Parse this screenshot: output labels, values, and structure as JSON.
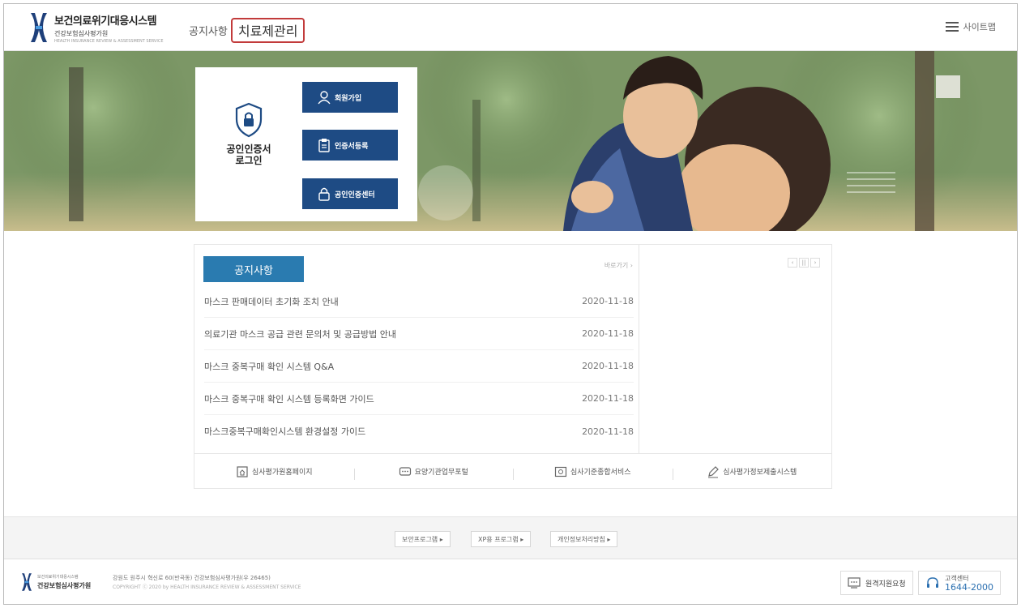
{
  "header": {
    "logo_title": "보건의료위기대응시스템",
    "logo_subtitle": "건강보험심사평가원",
    "logo_tagline": "HEALTH INSURANCE REVIEW & ASSESSMENT SERVICE",
    "nav": [
      {
        "label": "공지사항",
        "active": false
      },
      {
        "label": "치료제관리",
        "active": true
      }
    ],
    "sitemap_label": "사이트맵"
  },
  "login": {
    "title_line1": "공인인증서",
    "title_line2": "로그인",
    "buttons": [
      {
        "label": "회원가입",
        "icon": "user-icon"
      },
      {
        "label": "인증서등록",
        "icon": "clipboard-icon"
      },
      {
        "label": "공인인증센터",
        "icon": "lock-icon"
      }
    ]
  },
  "notice": {
    "title": "공지사항",
    "more_label": "바로가기 ›",
    "items": [
      {
        "title": "마스크 판매데이터 초기화 조치 안내",
        "date": "2020-11-18"
      },
      {
        "title": "의료기관 마스크 공급 관련 문의처 및 공급방법 안내",
        "date": "2020-11-18"
      },
      {
        "title": "마스크 중복구매 확인 시스템 Q&A",
        "date": "2020-11-18"
      },
      {
        "title": "마스크 중복구매 확인 시스템 등록화면 가이드",
        "date": "2020-11-18"
      },
      {
        "title": "마스크중복구매확인시스템 환경설정 가이드",
        "date": "2020-11-18"
      }
    ],
    "pager": [
      "‹",
      "||",
      "›"
    ]
  },
  "quick_links": [
    {
      "label": "심사평가원홈페이지",
      "icon": "home-doc-icon"
    },
    {
      "label": "요양기관업무포털",
      "icon": "chat-icon"
    },
    {
      "label": "심사기준종합서비스",
      "icon": "screen-icon"
    },
    {
      "label": "심사평가정보제출시스템",
      "icon": "pen-icon"
    }
  ],
  "footer": {
    "links": [
      "보안프로그램 ▸",
      "XP용 프로그램 ▸",
      "개인정보처리방침 ▸"
    ],
    "logo_line1": "보건의료위기대응시스템",
    "logo_line2": "건강보험심사평가원",
    "address": "강원도 원주시 혁신로 60(반곡동) 건강보험심사평가원(우 26465)",
    "copyright": "COPYRIGHT ⓒ 2020 by HEALTH INSURANCE REVIEW & ASSESSMENT SERVICE",
    "remote_support": "원격지원요청",
    "customer_center_label": "고객센터",
    "customer_center_phone": "1644-2000"
  },
  "colors": {
    "brand_blue": "#1e4b84",
    "notice_blue": "#2a7bb0",
    "highlight_red": "#c23b3b",
    "phone_blue": "#2a6fb0"
  }
}
